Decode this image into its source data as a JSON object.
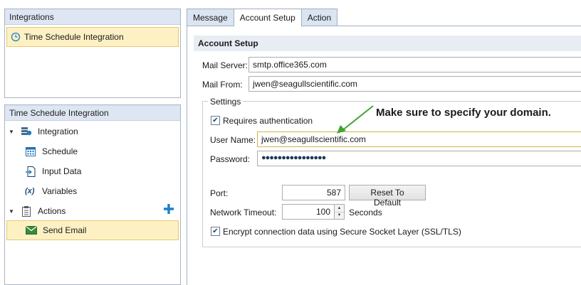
{
  "integrations_panel": {
    "title": "Integrations",
    "items": [
      {
        "label": "Time Schedule Integration"
      }
    ]
  },
  "tree_panel": {
    "title": "Time Schedule Integration",
    "integration_label": "Integration",
    "schedule_label": "Schedule",
    "input_data_label": "Input Data",
    "variables_label": "Variables",
    "variables_icon_text": "(x)",
    "actions_label": "Actions",
    "send_email_label": "Send Email"
  },
  "tabs": [
    {
      "label": "Message"
    },
    {
      "label": "Account Setup"
    },
    {
      "label": "Action"
    }
  ],
  "account_setup": {
    "section_title": "Account Setup",
    "mail_server_label": "Mail Server:",
    "mail_server_value": "smtp.office365.com",
    "mail_from_label": "Mail From:",
    "mail_from_value": "jwen@seagullscientific.com"
  },
  "settings": {
    "group_title": "Settings",
    "requires_auth_label": "Requires authentication",
    "requires_auth_checked": true,
    "user_name_label": "User Name:",
    "user_name_value": "jwen@seagullscientific.com",
    "password_label": "Password:",
    "password_value": "●●●●●●●●●●●●●●●●",
    "port_label": "Port:",
    "port_value": "587",
    "reset_button_label": "Reset To Default",
    "timeout_label": "Network Timeout:",
    "timeout_value": "100",
    "timeout_unit": "Seconds",
    "ssl_label": "Encrypt connection data using Secure Socket Layer (SSL/TLS)",
    "ssl_checked": true
  },
  "annotation": {
    "text": "Make sure to specify your domain.",
    "arrow_color": "#3fa535"
  },
  "colors": {
    "selection_bg": "#fdf1c4",
    "header_bg": "#dde6f2",
    "accent_blue": "#1f7fc4"
  }
}
